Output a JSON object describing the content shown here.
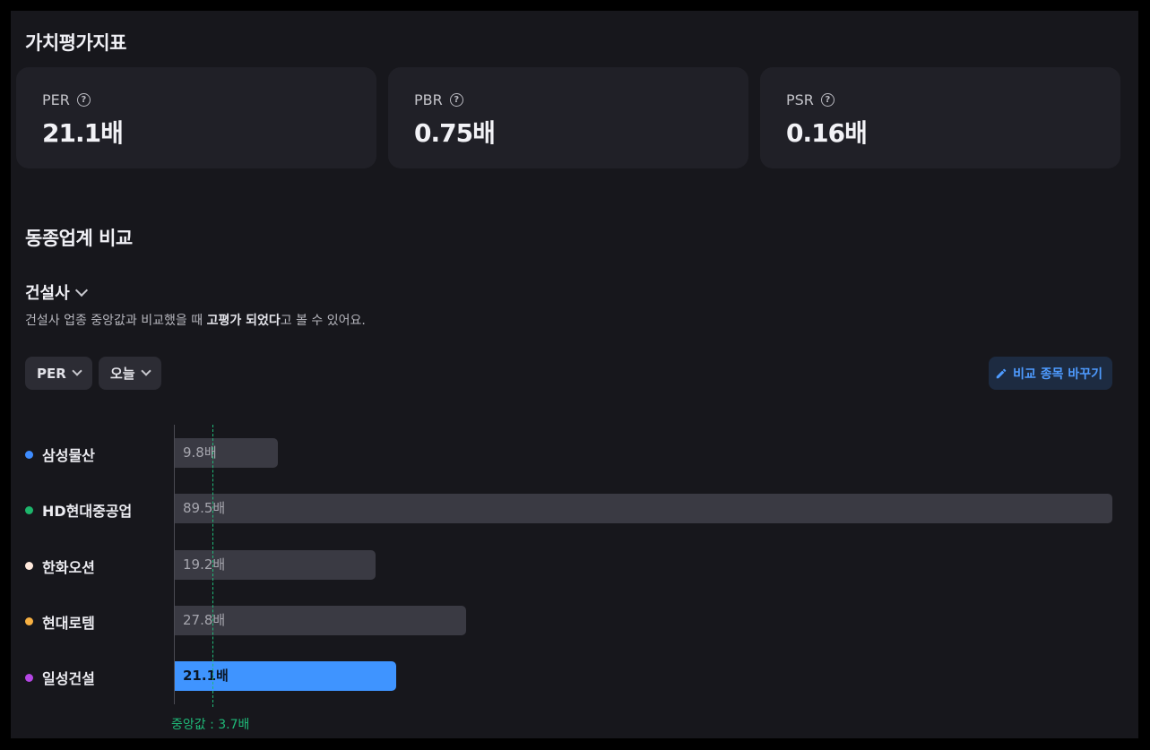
{
  "valuation": {
    "title": "가치평가지표",
    "cards": [
      {
        "label": "PER",
        "value": "21.1배"
      },
      {
        "label": "PBR",
        "value": "0.75배"
      },
      {
        "label": "PSR",
        "value": "0.16배"
      }
    ]
  },
  "peer": {
    "title": "동종업계 비교",
    "sector": "건설사",
    "desc_prefix": "건설사 업종 중앙값과 비교했을 때 ",
    "desc_bold": "고평가 되었다",
    "desc_suffix": "고 볼 수 있어요.",
    "metric": "PER",
    "period": "오늘",
    "change_label": "비교 종목 바꾸기",
    "median_label": "중앙값 : 3.7배"
  },
  "chart_data": {
    "type": "bar",
    "orientation": "horizontal",
    "categories": [
      "삼성물산",
      "HD현대중공업",
      "한화오션",
      "현대로템",
      "일성건설"
    ],
    "values": [
      9.8,
      89.5,
      19.2,
      27.8,
      21.1
    ],
    "value_labels": [
      "9.8배",
      "89.5배",
      "19.2배",
      "27.8배",
      "21.1배"
    ],
    "dot_colors": [
      "#3e8cff",
      "#1db56b",
      "#ffe9dc",
      "#f7b042",
      "#b546e4"
    ],
    "highlight_index": 4,
    "median": 3.7,
    "unit": "배"
  }
}
